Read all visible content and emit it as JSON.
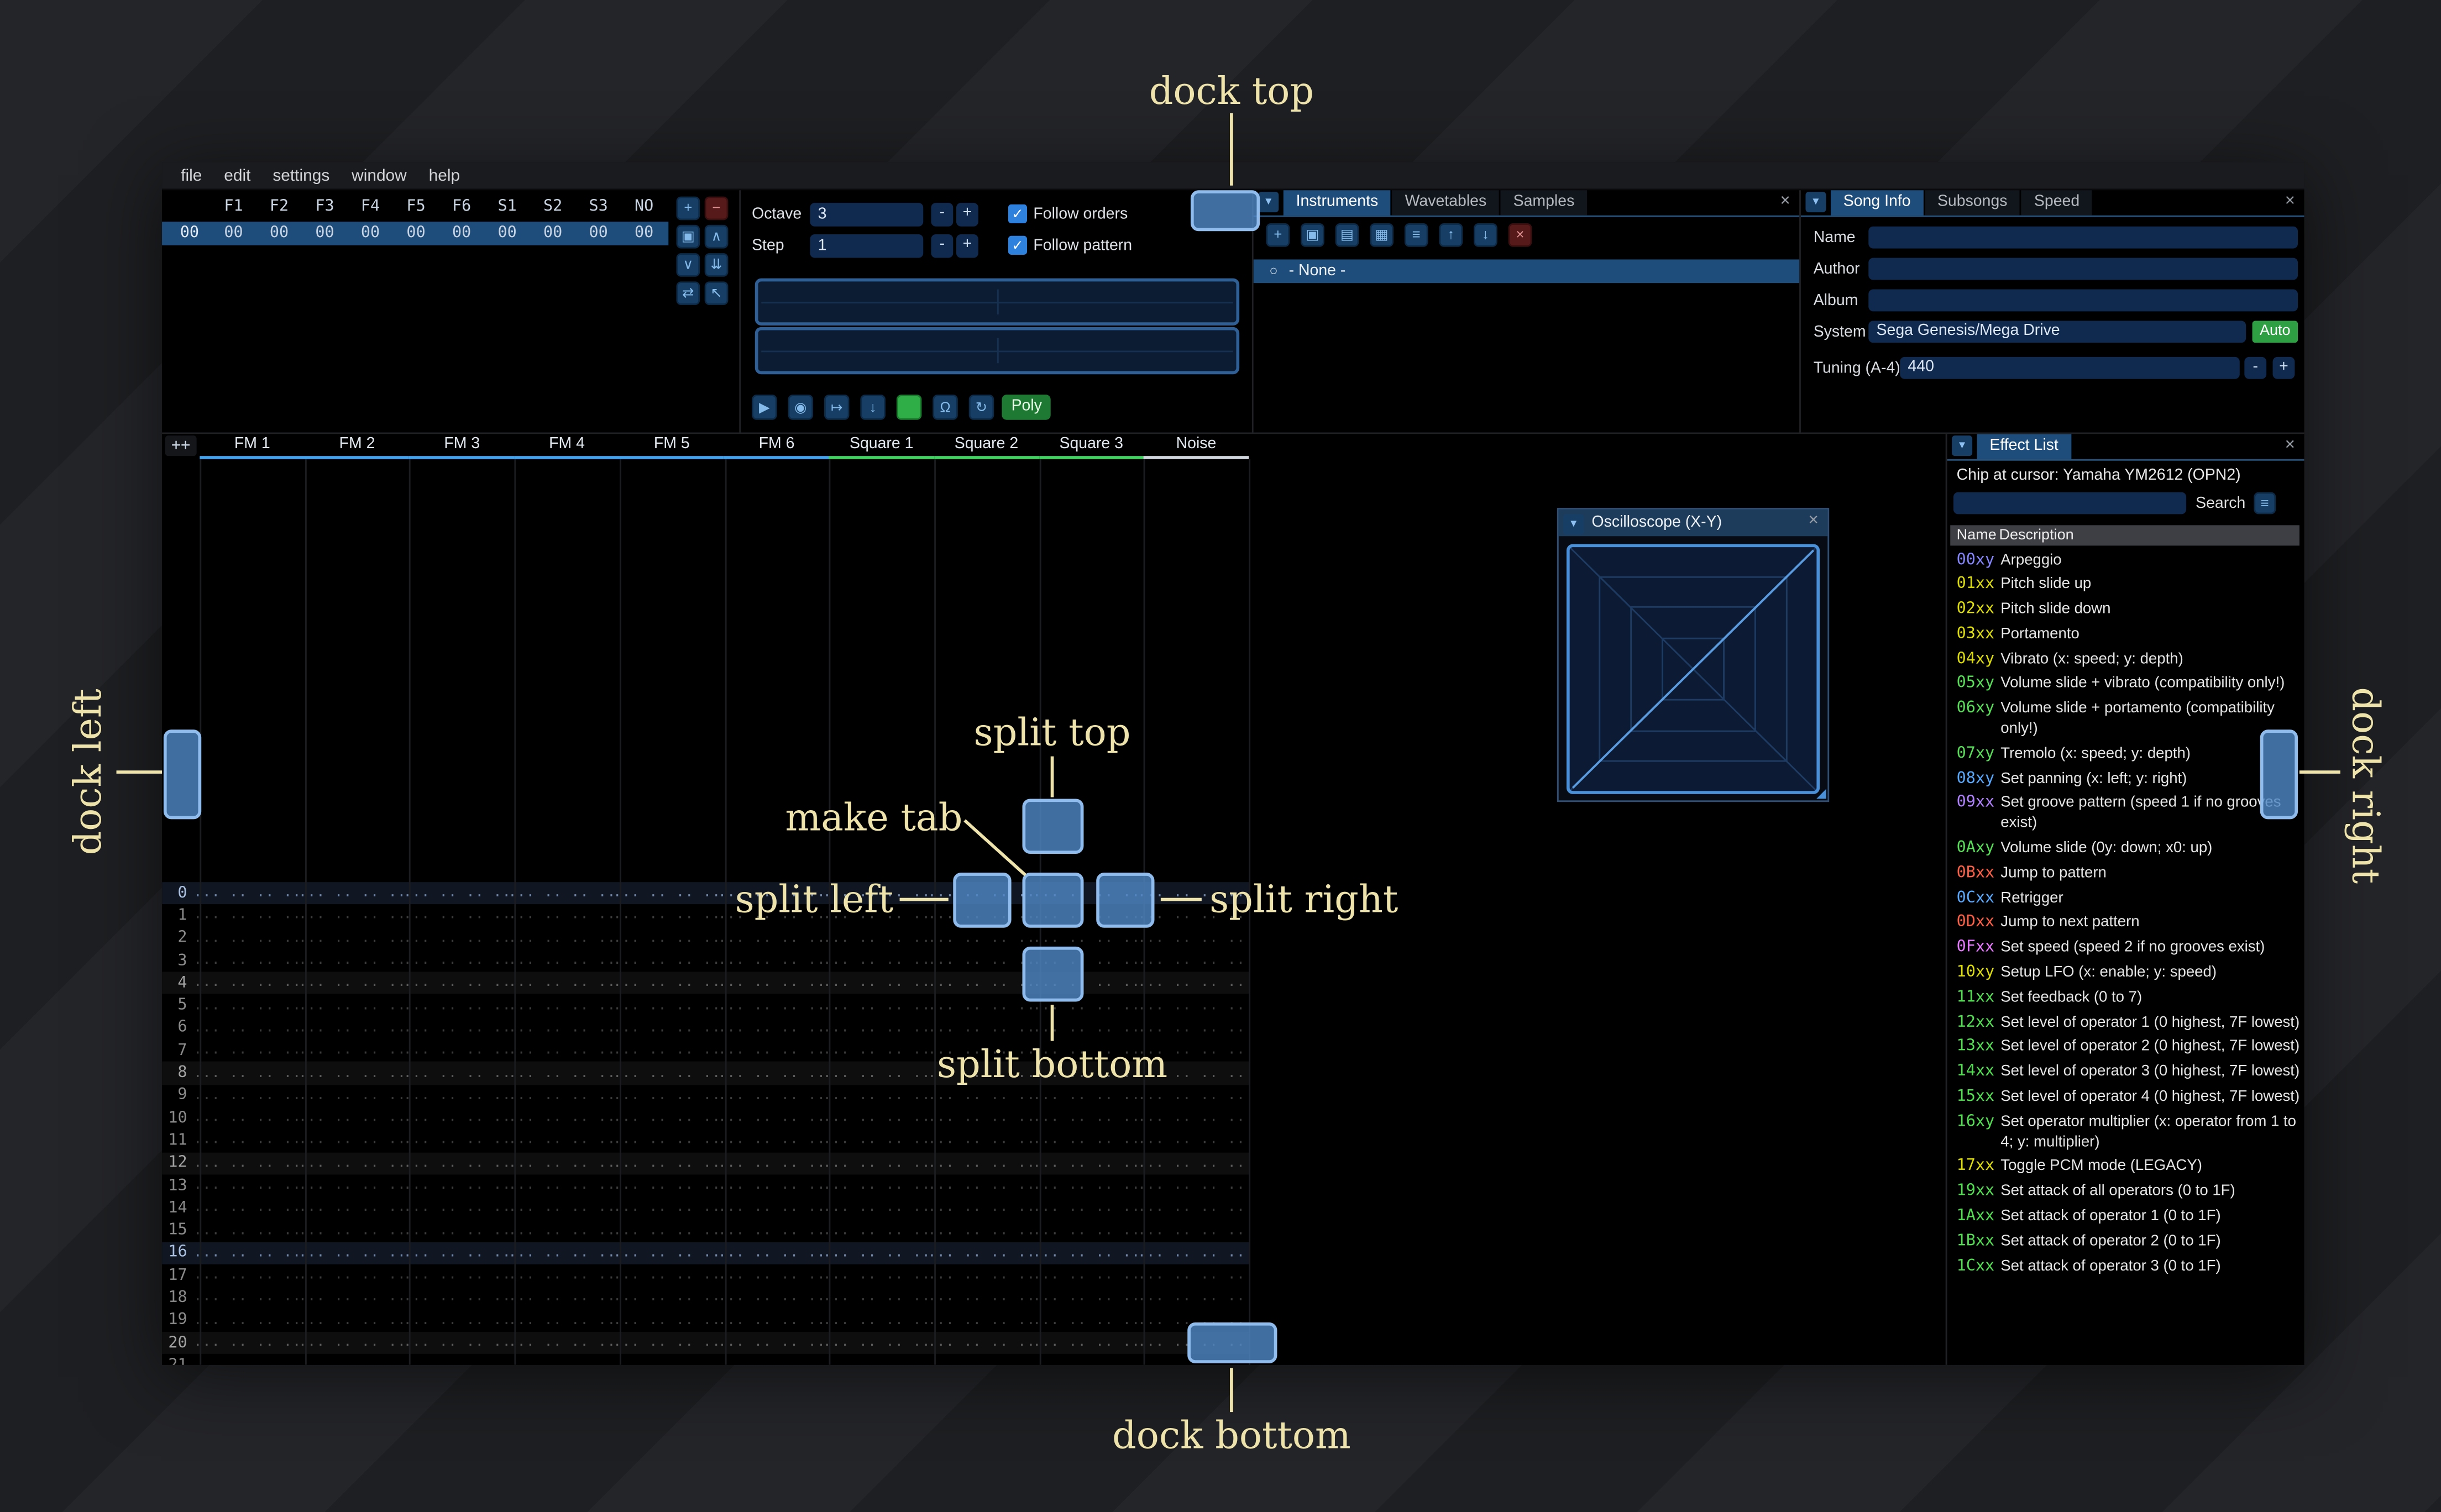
{
  "labels": {
    "dock_top": "dock top",
    "dock_left": "dock left",
    "dock_right": "dock right",
    "dock_bottom": "dock bottom",
    "split_top": "split top",
    "split_left": "split left",
    "split_right": "split right",
    "split_bottom": "split bottom",
    "make_tab": "make tab"
  },
  "menu": {
    "items": [
      "file",
      "edit",
      "settings",
      "window",
      "help"
    ]
  },
  "icons": {
    "close": "×",
    "collapse": "▼",
    "radio": "○",
    "hamburger": "≡",
    "resize_grip": "◢",
    "check": "✓"
  },
  "orders": {
    "columns": [
      "F1",
      "F2",
      "F3",
      "F4",
      "F5",
      "F6",
      "S1",
      "S2",
      "S3",
      "NO"
    ],
    "row": {
      "index": "00",
      "values": [
        "00",
        "00",
        "00",
        "00",
        "00",
        "00",
        "00",
        "00",
        "00",
        "00"
      ]
    },
    "buttons": [
      {
        "name": "add-order",
        "glyph": "+",
        "variant": "blue"
      },
      {
        "name": "remove-order",
        "glyph": "−",
        "variant": "red"
      },
      {
        "name": "duplicate-order",
        "glyph": "▣",
        "variant": "blue"
      },
      {
        "name": "move-order-up",
        "glyph": "∧",
        "variant": "blue"
      },
      {
        "name": "move-order-down",
        "glyph": "∨",
        "variant": "blue"
      },
      {
        "name": "duplicate-order-end",
        "glyph": "⇊",
        "variant": "blue"
      },
      {
        "name": "order-change-mode",
        "glyph": "⇄",
        "variant": "blue"
      },
      {
        "name": "order-edit-mode",
        "glyph": "↖",
        "variant": "blue"
      }
    ]
  },
  "controls": {
    "octave_label": "Octave",
    "octave_value": "3",
    "step_label": "Step",
    "step_value": "1",
    "dec_label": "-",
    "inc_label": "+",
    "follow_orders_label": "Follow orders",
    "follow_pattern_label": "Follow pattern",
    "transport": [
      {
        "name": "play",
        "glyph": "▶",
        "variant": "blue"
      },
      {
        "name": "play-pattern",
        "glyph": "◉",
        "variant": "blue"
      },
      {
        "name": "play-from-cursor",
        "glyph": "↦",
        "variant": "blue"
      },
      {
        "name": "step-row",
        "glyph": "↓",
        "variant": "blue"
      },
      {
        "name": "edit-toggle",
        "glyph": "",
        "variant": "green"
      },
      {
        "name": "metronome",
        "glyph": "Ω",
        "variant": "blue"
      },
      {
        "name": "repeat-pattern",
        "glyph": "↻",
        "variant": "blue"
      }
    ],
    "poly_label": "Poly"
  },
  "instruments": {
    "tabs": [
      "Instruments",
      "Wavetables",
      "Samples"
    ],
    "selected_tab": 0,
    "toolbar": [
      {
        "name": "add-instrument",
        "glyph": "+",
        "variant": "blue"
      },
      {
        "name": "duplicate-instrument",
        "glyph": "▣",
        "variant": "blue"
      },
      {
        "name": "open-instrument",
        "glyph": "▤",
        "variant": "blue"
      },
      {
        "name": "save-instrument",
        "glyph": "▦",
        "variant": "blue"
      },
      {
        "name": "instrument-menu",
        "glyph": "≡",
        "variant": "blue"
      },
      {
        "name": "move-instrument-up",
        "glyph": "↑",
        "variant": "blue"
      },
      {
        "name": "move-instrument-down",
        "glyph": "↓",
        "variant": "blue"
      },
      {
        "name": "delete-instrument",
        "glyph": "×",
        "variant": "red"
      }
    ],
    "items": [
      "- None -"
    ]
  },
  "song_info": {
    "tabs": [
      "Song Info",
      "Subsongs",
      "Speed"
    ],
    "selected_tab": 0,
    "name_label": "Name",
    "name_value": "",
    "author_label": "Author",
    "author_value": "",
    "album_label": "Album",
    "album_value": "",
    "system_label": "System",
    "system_value": "Sega Genesis/Mega Drive",
    "auto_label": "Auto",
    "tuning_label": "Tuning (A-4)",
    "tuning_value": "440"
  },
  "pattern": {
    "add_channel_label": "++",
    "channels": [
      {
        "label": "FM 1",
        "type": "fm"
      },
      {
        "label": "FM 2",
        "type": "fm"
      },
      {
        "label": "FM 3",
        "type": "fm"
      },
      {
        "label": "FM 4",
        "type": "fm"
      },
      {
        "label": "FM 5",
        "type": "fm"
      },
      {
        "label": "FM 6",
        "type": "fm"
      },
      {
        "label": "Square 1",
        "type": "psg"
      },
      {
        "label": "Square 2",
        "type": "psg"
      },
      {
        "label": "Square 3",
        "type": "psg"
      },
      {
        "label": "Noise",
        "type": "noise"
      }
    ],
    "channel_colors": {
      "fm": "#41a3f0",
      "psg": "#3fd35f",
      "noise": "#cfd6dd"
    },
    "row_count": 22,
    "empty_cell": "... .. .. .."
  },
  "oscilloscope": {
    "title": "Oscilloscope (X-Y)"
  },
  "effect_list": {
    "tab": "Effect List",
    "chip_label": "Chip at cursor: Yamaha YM2612 (OPN2)",
    "search_label": "Search",
    "search_value": "",
    "name_header": "Name",
    "desc_header": "Description",
    "effects": [
      {
        "code": "00xy",
        "color": "#8585ff",
        "desc": "Arpeggio"
      },
      {
        "code": "01xx",
        "color": "#dede00",
        "desc": "Pitch slide up"
      },
      {
        "code": "02xx",
        "color": "#dede00",
        "desc": "Pitch slide down"
      },
      {
        "code": "03xx",
        "color": "#dede00",
        "desc": "Portamento"
      },
      {
        "code": "04xy",
        "color": "#dede00",
        "desc": "Vibrato (x: speed; y: depth)"
      },
      {
        "code": "05xy",
        "color": "#55e055",
        "desc": "Volume slide + vibrato (compatibility only!)"
      },
      {
        "code": "06xy",
        "color": "#55e055",
        "desc": "Volume slide + portamento (compatibility only!)"
      },
      {
        "code": "07xy",
        "color": "#55e055",
        "desc": "Tremolo (x: speed; y: depth)"
      },
      {
        "code": "08xy",
        "color": "#55aaff",
        "desc": "Set panning (x: left; y: right)"
      },
      {
        "code": "09xx",
        "color": "#b080ff",
        "desc": "Set groove pattern (speed 1 if no grooves exist)"
      },
      {
        "code": "0Axy",
        "color": "#55e055",
        "desc": "Volume slide (0y: down; x0: up)"
      },
      {
        "code": "0Bxx",
        "color": "#ff5f45",
        "desc": "Jump to pattern"
      },
      {
        "code": "0Cxx",
        "color": "#55aaff",
        "desc": "Retrigger"
      },
      {
        "code": "0Dxx",
        "color": "#ff5f45",
        "desc": "Jump to next pattern"
      },
      {
        "code": "0Fxx",
        "color": "#e878ff",
        "desc": "Set speed (speed 2 if no grooves exist)"
      },
      {
        "code": "10xy",
        "color": "#dede00",
        "desc": "Setup LFO (x: enable; y: speed)"
      },
      {
        "code": "11xx",
        "color": "#50e050",
        "desc": "Set feedback (0 to 7)"
      },
      {
        "code": "12xx",
        "color": "#50e050",
        "desc": "Set level of operator 1 (0 highest, 7F lowest)"
      },
      {
        "code": "13xx",
        "color": "#50e050",
        "desc": "Set level of operator 2 (0 highest, 7F lowest)"
      },
      {
        "code": "14xx",
        "color": "#50e050",
        "desc": "Set level of operator 3 (0 highest, 7F lowest)"
      },
      {
        "code": "15xx",
        "color": "#50e050",
        "desc": "Set level of operator 4 (0 highest, 7F lowest)"
      },
      {
        "code": "16xy",
        "color": "#50e050",
        "desc": "Set operator multiplier (x: operator from 1 to 4; y: multiplier)"
      },
      {
        "code": "17xx",
        "color": "#dede00",
        "desc": "Toggle PCM mode (LEGACY)"
      },
      {
        "code": "19xx",
        "color": "#50e050",
        "desc": "Set attack of all operators (0 to 1F)"
      },
      {
        "code": "1Axx",
        "color": "#50e050",
        "desc": "Set attack of operator 1 (0 to 1F)"
      },
      {
        "code": "1Bxx",
        "color": "#50e050",
        "desc": "Set attack of operator 2 (0 to 1F)"
      },
      {
        "code": "1Cxx",
        "color": "#50e050",
        "desc": "Set attack of operator 3 (0 to 1F)"
      }
    ]
  }
}
